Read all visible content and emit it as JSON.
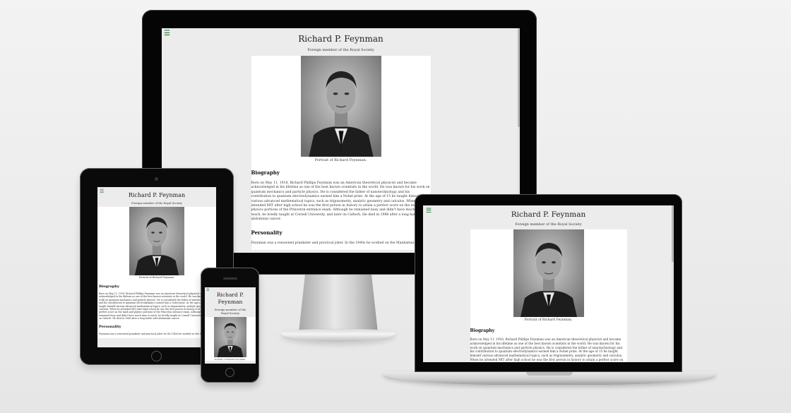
{
  "site": {
    "menu_icon": "hamburger-menu-icon",
    "title": "Richard P. Feynman",
    "subtitle": "Foreign member of the Royal Society",
    "photo_caption": "Portrait of Richard Feynman.",
    "biography_heading": "Biography",
    "biography_text": "Born on May 11, 1918, Richard Phillips Feynman was an American theoretical physicist and became acknowledged in his lifetime as one of the best known scientists in the world. He was known for his work on quantum mechanics and particle physics. He is considered the father of nanotechnology and his contribution to quantum electrodynamics earned him a Nobel prize. At the age of 15 he taught himself various advanced mathematical topics, such as trigonometry, analytic geometry and calculus. When he attended MIT after high school he was the first person in history to attain a perfect score on the math and physics portions of the Princeton entrance exam. Although he remained busy and didn't have much time to teach, he briefly taught at Cornell University, and later on Caltech. He died in 1988 after a long battle with abdominal cancer.",
    "personality_heading": "Personality",
    "personality_text": "Feynman was a renowned prankster and practical joker. In the 1940s he worked on the Manhattan"
  },
  "colors": {
    "background": "#eaeaea",
    "menu_icon": "#1b6b2b",
    "device_frame": "#050505"
  }
}
